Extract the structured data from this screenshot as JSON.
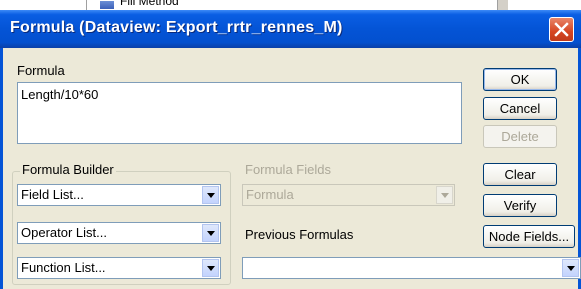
{
  "background_window": {
    "text": "Fill Method"
  },
  "window": {
    "title": "Formula (Dataview: Export_rrtr_rennes_M)",
    "titlebar_color": "#0454d6",
    "close_color": "#d64521"
  },
  "formula": {
    "label": "Formula",
    "value": "Length/10*60"
  },
  "buttons": {
    "ok": "OK",
    "cancel": "Cancel",
    "delete": "Delete",
    "clear": "Clear",
    "verify": "Verify",
    "node_fields": "Node Fields..."
  },
  "formula_builder": {
    "label": "Formula Builder",
    "field_list": "Field List...",
    "operator_list": "Operator List...",
    "function_list": "Function List..."
  },
  "formula_fields": {
    "label": "Formula Fields",
    "selected": "Formula"
  },
  "previous_formulas": {
    "label": "Previous Formulas",
    "selected": ""
  }
}
